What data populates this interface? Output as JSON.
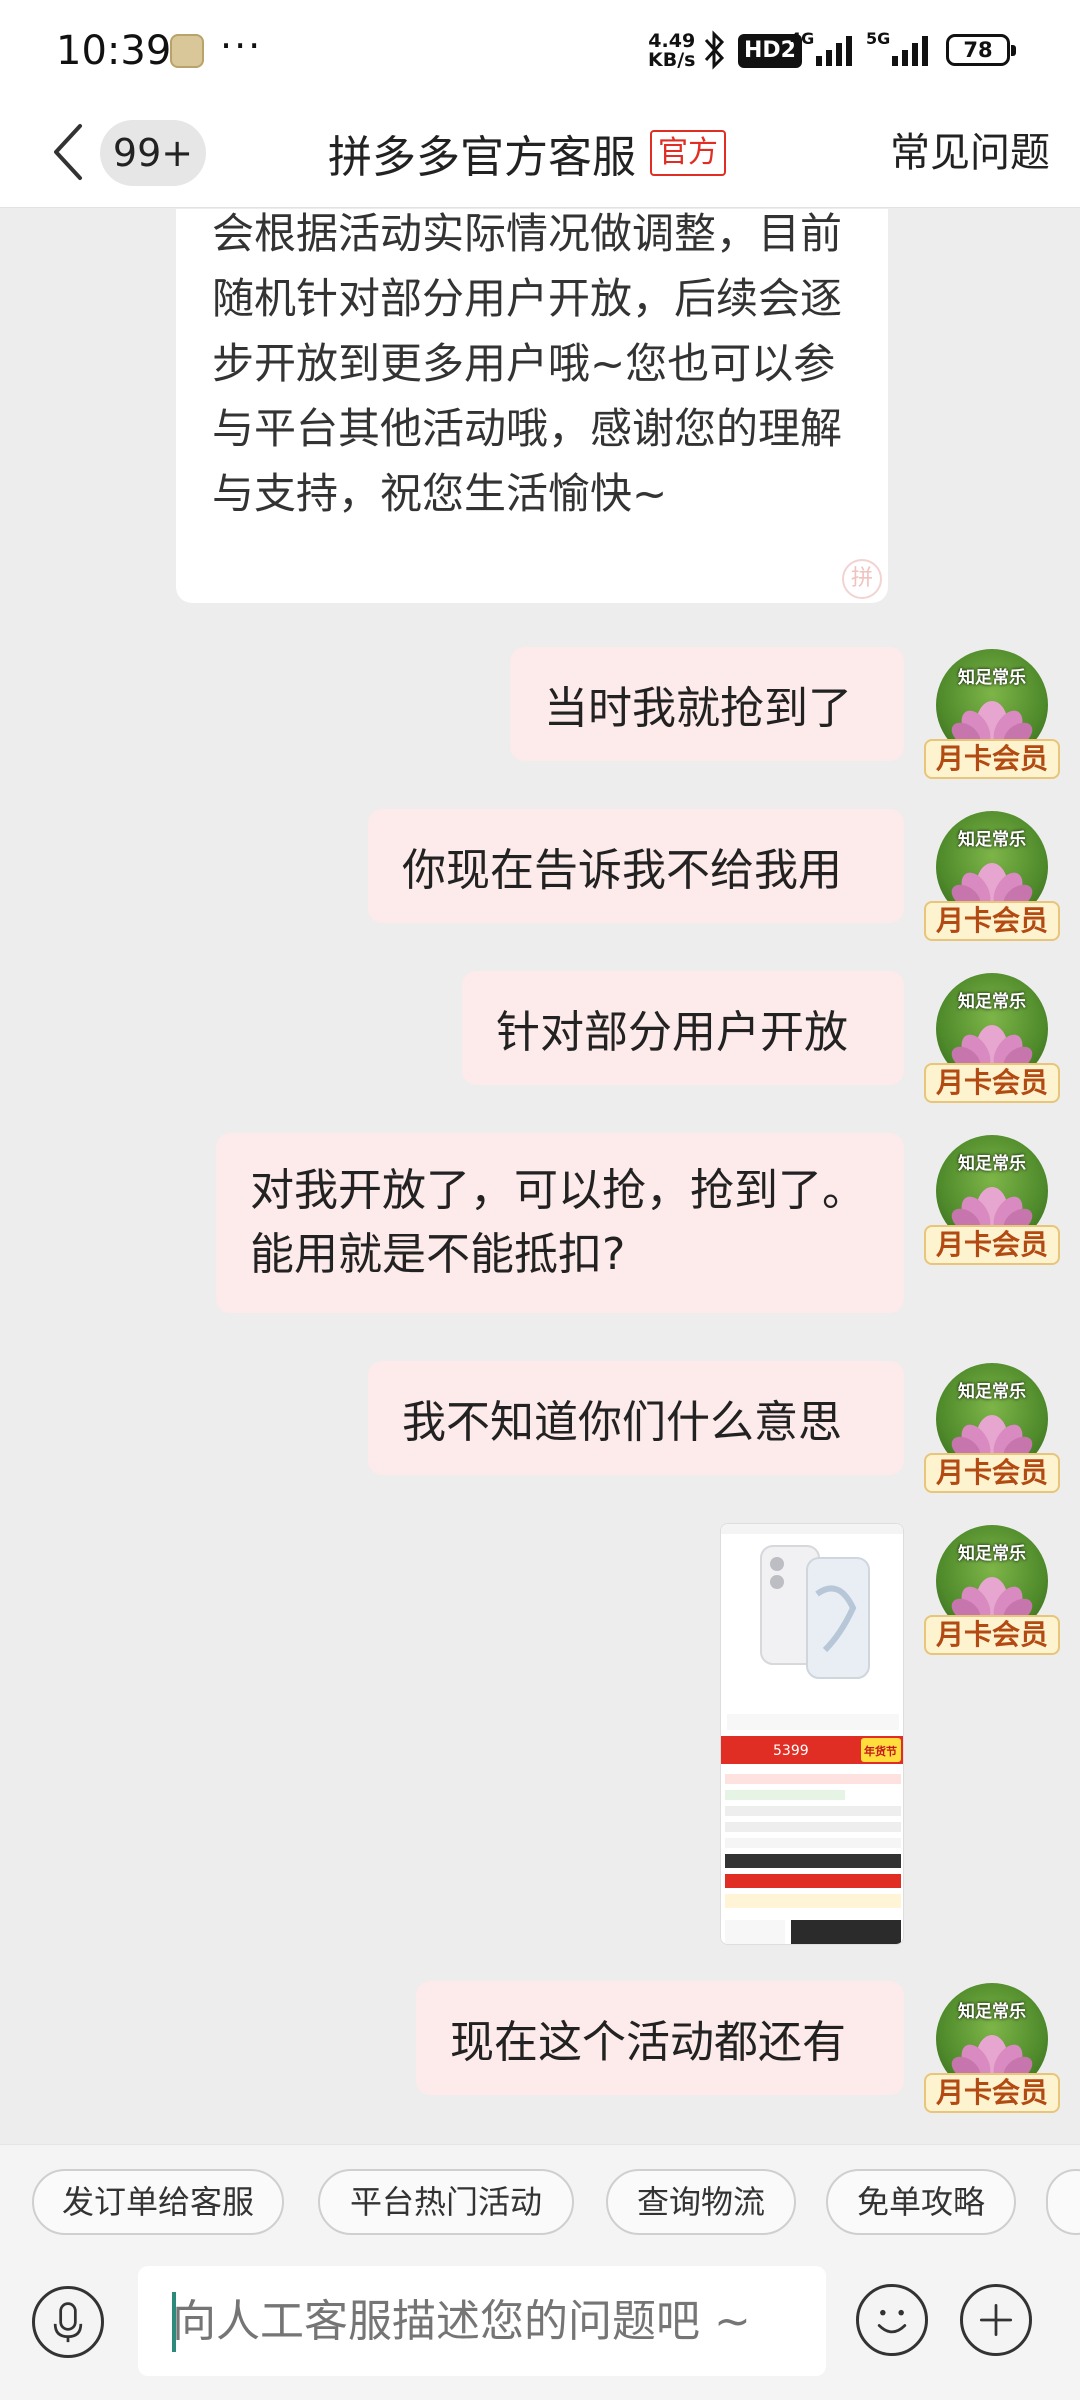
{
  "status_bar": {
    "time": "10:39",
    "dots": "···",
    "net_speed_value": "4.49",
    "net_speed_unit": "KB/s",
    "hd_label": "HD2",
    "sig1_label": "4G",
    "sig2_label": "5G",
    "battery": "78"
  },
  "header": {
    "unread_count": "99+",
    "title": "拼多多官方客服",
    "official_tag": "官方",
    "faq_label": "常见问题"
  },
  "incoming_message": "会根据活动实际情况做调整，目前随机针对部分用户开放，后续会逐步开放到更多用户哦~您也可以参与平台其他活动哦，感谢您的理解与支持，祝您生活愉快~",
  "user": {
    "avatar_text": "知足常乐",
    "member_badge": "月卡会员"
  },
  "messages": [
    {
      "text": "当时我就抢到了"
    },
    {
      "text": "你现在告诉我不给我用"
    },
    {
      "text": "针对部分用户开放"
    },
    {
      "text": "对我开放了，可以抢，抢到了。能用就是不能抵扣?"
    },
    {
      "text": "我不知道你们什么意思"
    },
    {
      "text": "现在这个活动都还有"
    }
  ],
  "screenshot_message": {
    "price": "5399",
    "festival": "年货节"
  },
  "quick_replies": [
    "发订单给客服",
    "平台热门活动",
    "查询物流",
    "免单攻略"
  ],
  "input": {
    "placeholder": "向人工客服描述您的问题吧 ~"
  },
  "colors": {
    "accent": "#e02e24",
    "bubble_out": "#fdeaea",
    "chat_bg": "#ededed"
  }
}
